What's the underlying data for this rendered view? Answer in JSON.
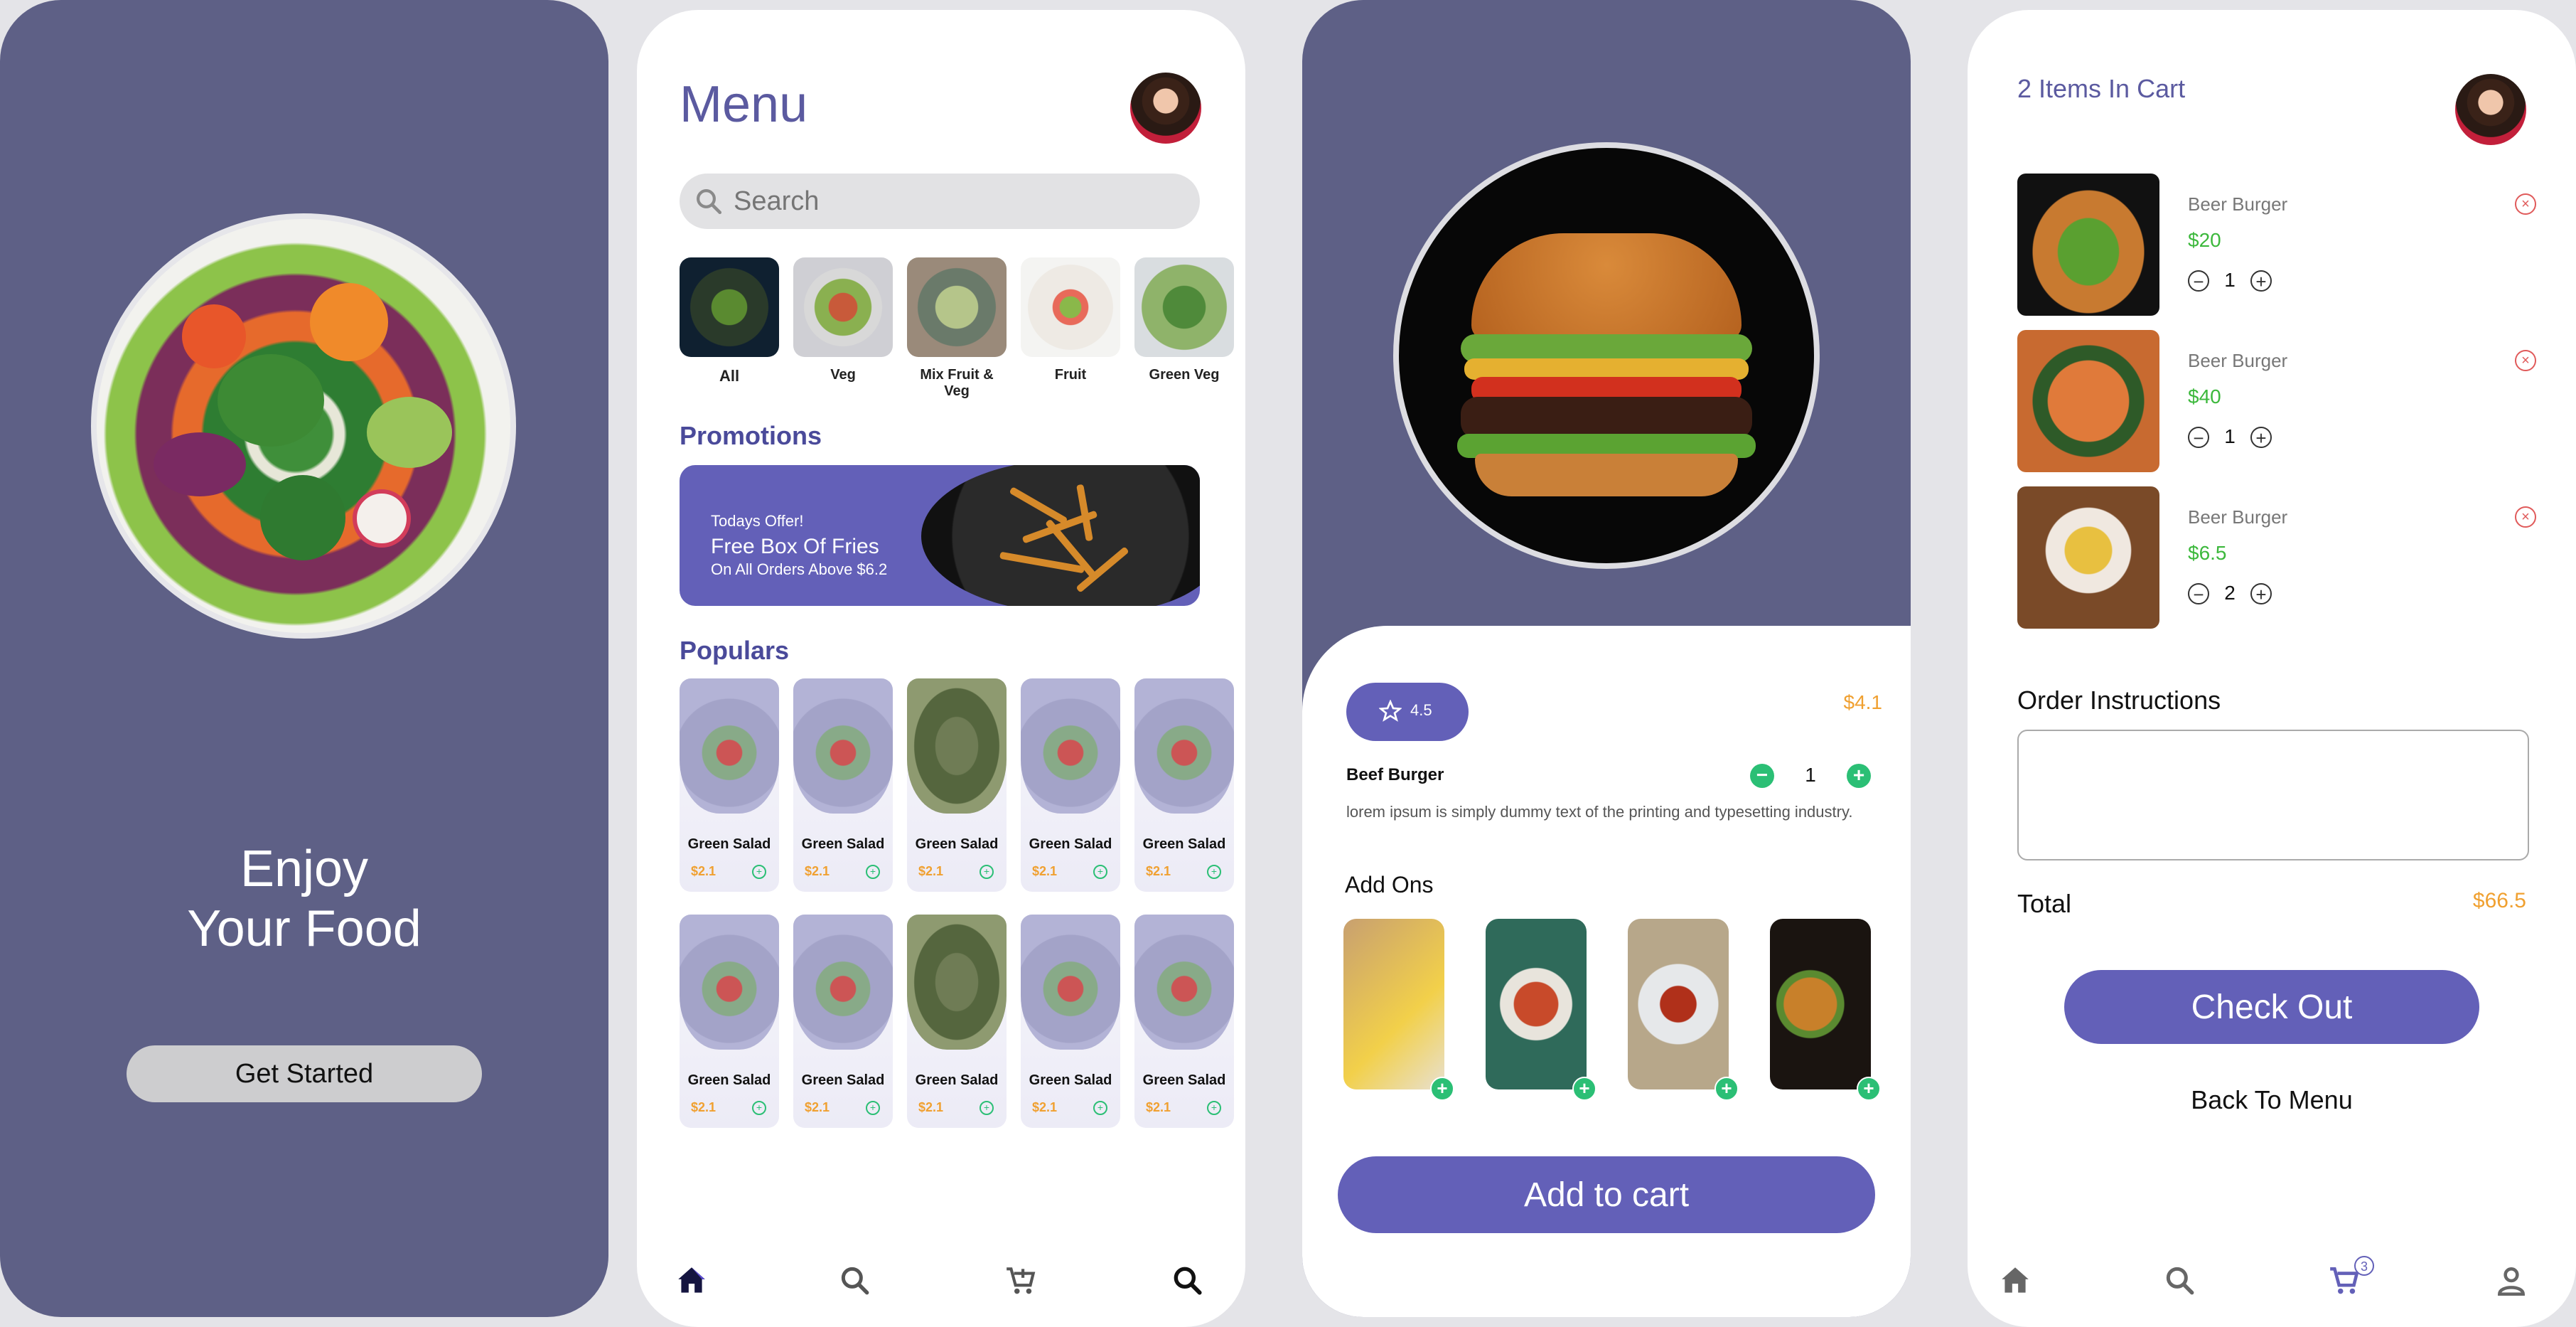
{
  "welcome": {
    "title_line1": "Enjoy",
    "title_line2": "Your Food",
    "cta_label": "Get Started"
  },
  "menu_screen": {
    "title": "Menu",
    "search_placeholder": "Search",
    "categories": [
      {
        "label": "All",
        "active": true
      },
      {
        "label": "Veg"
      },
      {
        "label": "Mix Fruit & Veg"
      },
      {
        "label": "Fruit"
      },
      {
        "label": "Green Veg"
      }
    ],
    "promotions_title": "Promotions",
    "promo": {
      "line1": "Todays Offer!",
      "line2": "Free Box Of Fries",
      "line3": "On All Orders Above $6.2"
    },
    "populars_title": "Populars",
    "populars": [
      {
        "name": "Green Salad",
        "price": "$2.1"
      },
      {
        "name": "Green Salad",
        "price": "$2.1"
      },
      {
        "name": "Green Salad",
        "price": "$2.1"
      },
      {
        "name": "Green Salad",
        "price": "$2.1"
      },
      {
        "name": "Green Salad",
        "price": "$2.1"
      },
      {
        "name": "Green Salad",
        "price": "$2.1"
      },
      {
        "name": "Green Salad",
        "price": "$2.1"
      },
      {
        "name": "Green Salad",
        "price": "$2.1"
      },
      {
        "name": "Green Salad",
        "price": "$2.1"
      },
      {
        "name": "Green Salad",
        "price": "$2.1"
      }
    ],
    "nav_icons": [
      "home-icon",
      "search-icon",
      "cart-icon",
      "search-alt-icon"
    ]
  },
  "detail_screen": {
    "rating": "4.5",
    "price": "$4.1",
    "item_name": "Beef Burger",
    "quantity": "1",
    "description": "lorem ipsum is simply dummy text of the printing and typesetting industry.",
    "addons_title": "Add Ons",
    "addons": [
      "fries",
      "soup",
      "salsa",
      "burger"
    ],
    "cta_label": "Add to cart"
  },
  "cart_screen": {
    "title": "2 Items In Cart",
    "items": [
      {
        "name": "Beer Burger",
        "price": "$20",
        "qty": "1"
      },
      {
        "name": "Beer Burger",
        "price": "$40",
        "qty": "1"
      },
      {
        "name": "Beer Burger",
        "price": "$6.5",
        "qty": "2"
      }
    ],
    "instructions_label": "Order Instructions",
    "total_label": "Total",
    "total_value": "$66.5",
    "checkout_label": "Check Out",
    "back_label": "Back To Menu",
    "cart_badge": "3",
    "nav_icons": [
      "home-icon",
      "search-icon",
      "cart-icon",
      "profile-icon"
    ]
  },
  "colors": {
    "primary": "#6360b8",
    "slate": "#5e6086",
    "accent_orange": "#f0a030",
    "accent_green": "#2bbf75"
  }
}
